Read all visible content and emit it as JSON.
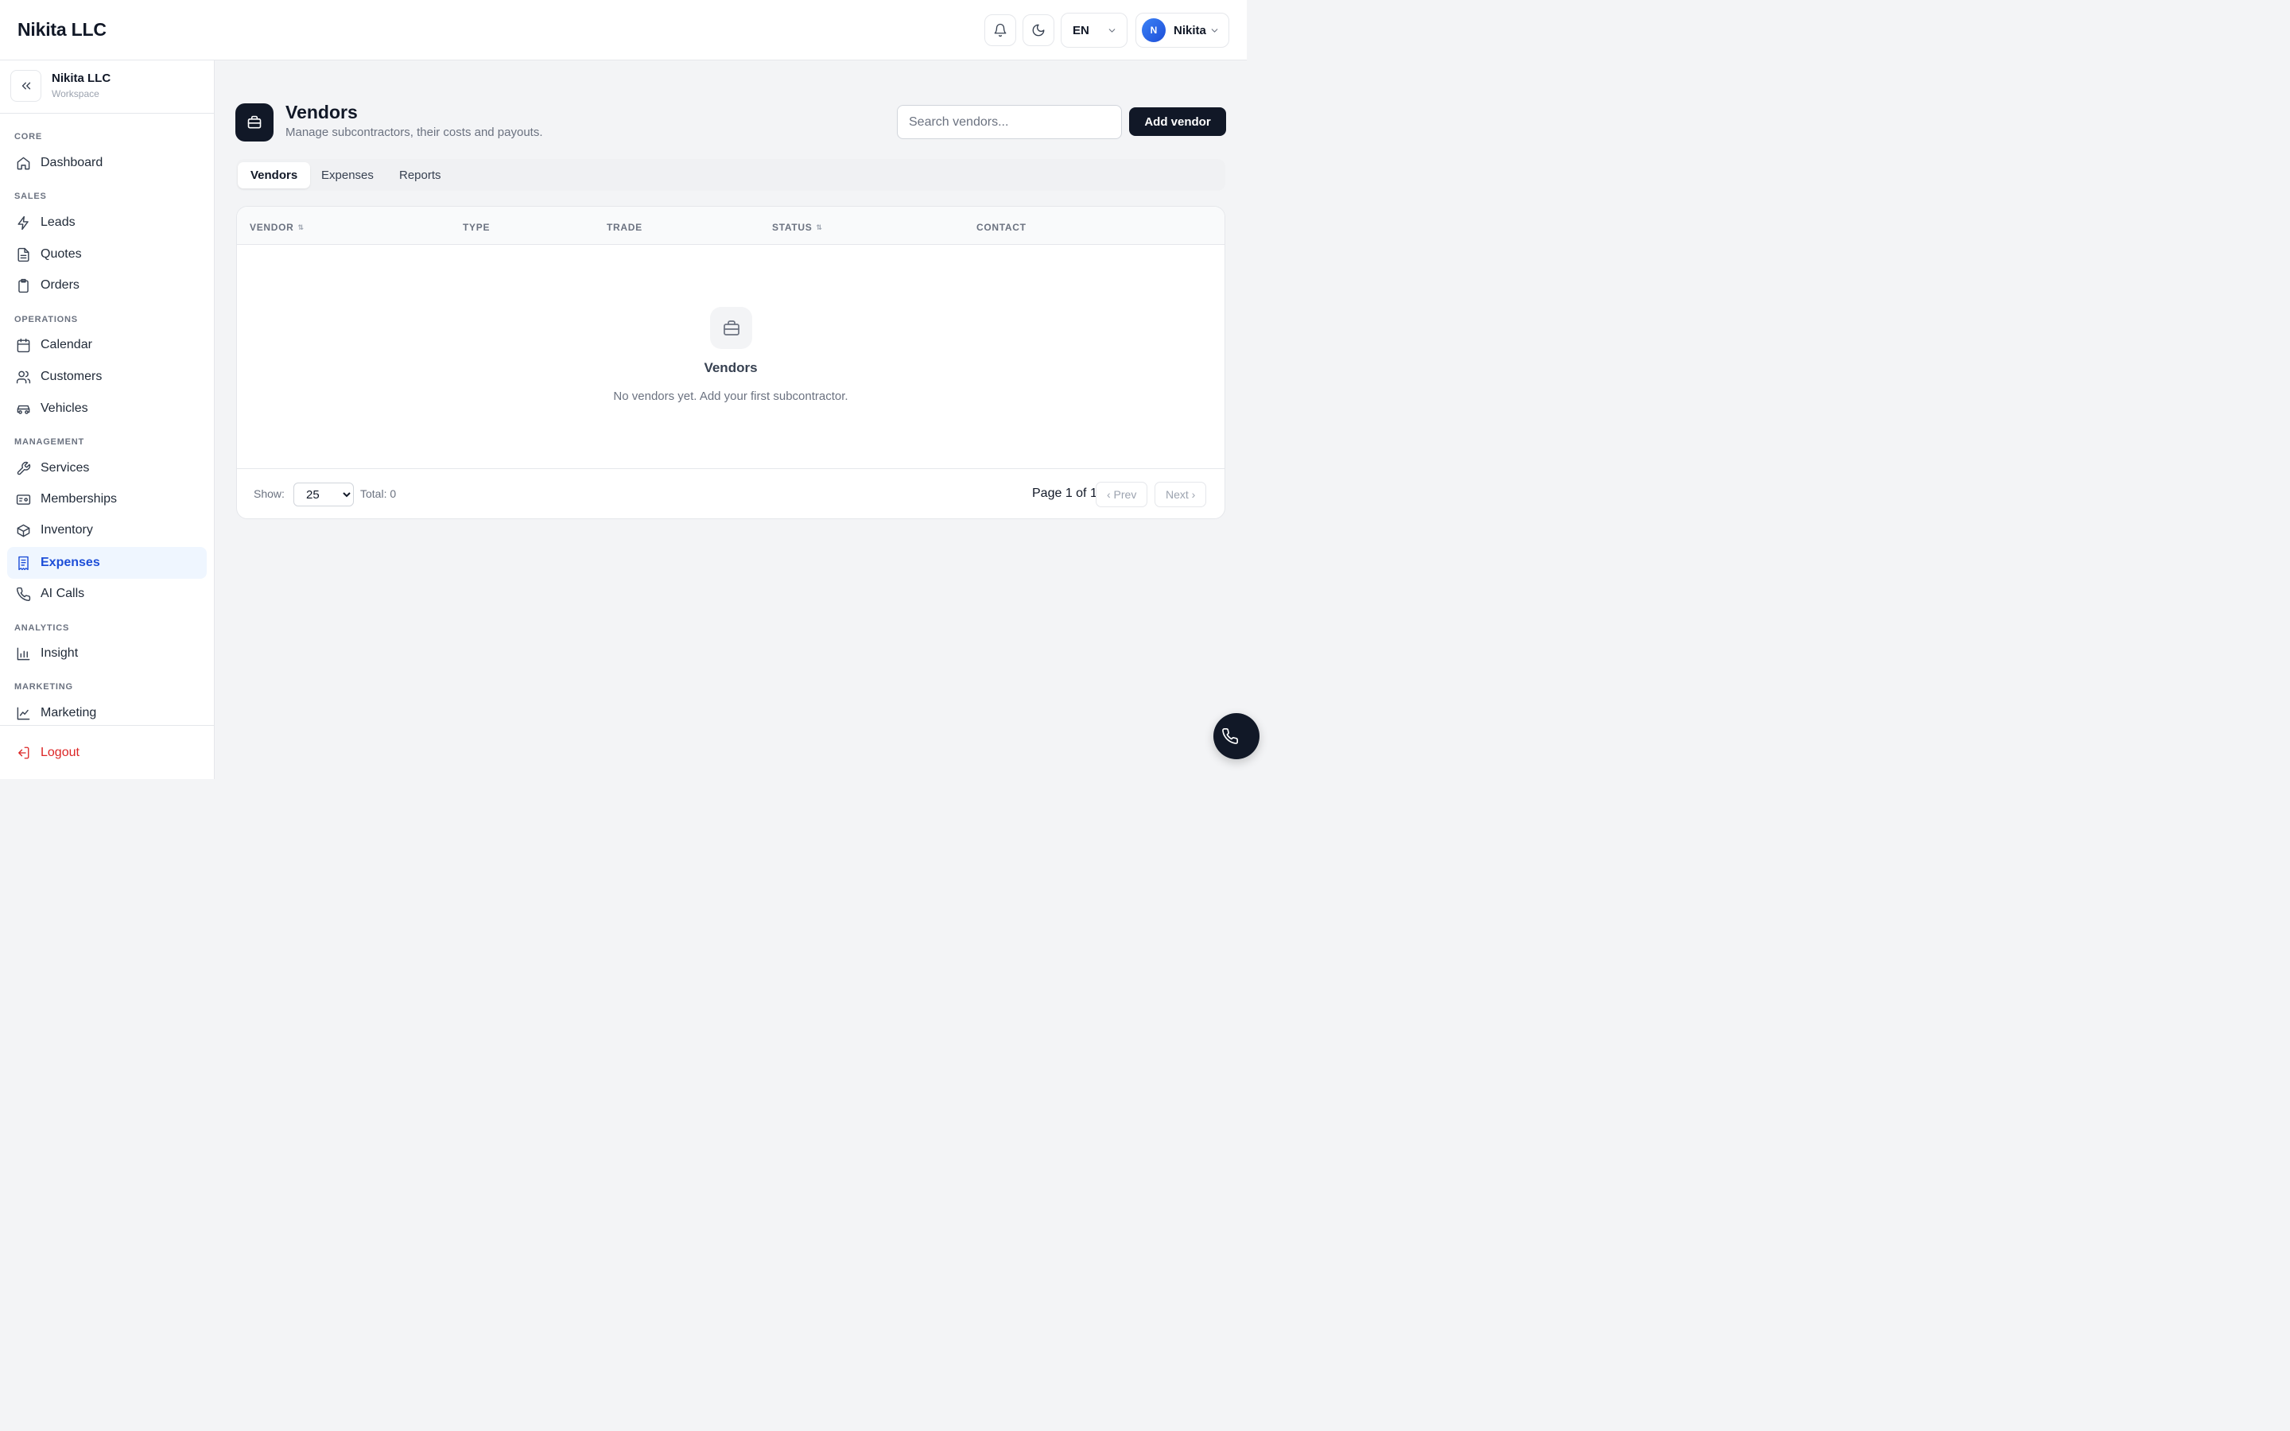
{
  "app": {
    "brand": "Nikita LLC"
  },
  "header": {
    "language": "EN",
    "user": {
      "initial": "N",
      "name": "Nikita"
    },
    "icons": [
      "bell-icon",
      "moon-icon",
      "chevron-down-icon"
    ]
  },
  "sidebar": {
    "workspace": {
      "name": "Nikita LLC",
      "subtitle": "Workspace"
    },
    "sections": {
      "core": "CORE",
      "sales": "SALES",
      "operations": "OPERATIONS",
      "management": "MANAGEMENT",
      "analytics": "ANALYTICS",
      "marketing": "MARKETING"
    },
    "items": {
      "dashboard": "Dashboard",
      "leads": "Leads",
      "quotes": "Quotes",
      "orders": "Orders",
      "calendar": "Calendar",
      "customers": "Customers",
      "vehicles": "Vehicles",
      "services": "Services",
      "memberships": "Memberships",
      "inventory": "Inventory",
      "expenses": "Expenses",
      "ai_calls": "AI Calls",
      "insight": "Insight",
      "marketing": "Marketing"
    },
    "active": "expenses",
    "logout": "Logout"
  },
  "page": {
    "title": "Vendors",
    "subtitle": "Manage subcontractors, their costs and payouts.",
    "search_placeholder": "Search vendors...",
    "add_button": "Add vendor",
    "tabs": [
      "Vendors",
      "Expenses",
      "Reports"
    ],
    "active_tab": "Vendors"
  },
  "table": {
    "columns": {
      "vendor": "VENDOR",
      "type": "TYPE",
      "trade": "TRADE",
      "status": "STATUS",
      "contact": "CONTACT"
    },
    "empty": {
      "title": "Vendors",
      "text": "No vendors yet. Add your first subcontractor."
    },
    "footer": {
      "show_label": "Show:",
      "page_size": "25",
      "total": "Total: 0",
      "page_info": "Page 1 of 1",
      "prev": "‹ Prev",
      "next": "Next ›"
    }
  },
  "colors": {
    "accent": "#1d4ed8",
    "active_bg": "#eff6ff",
    "dark": "#111827",
    "danger": "#dc2626"
  }
}
